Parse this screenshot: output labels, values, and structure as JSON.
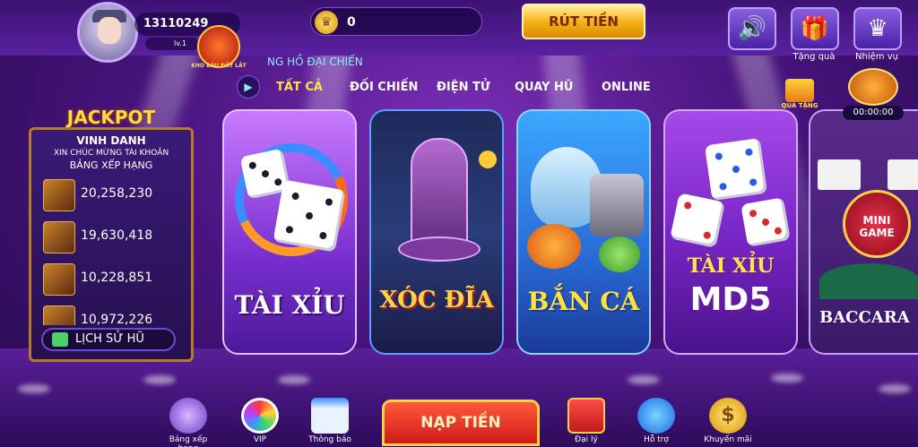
{
  "user": {
    "id": "13110249",
    "level": "lv.1"
  },
  "event_badge": "KHO BÁU ĐẦY LẮT",
  "wallet": {
    "coins": "0",
    "crown_icon": "crown-coin-icon"
  },
  "withdraw_label": "RÚT TIỀN",
  "top_buttons": [
    {
      "name": "sound",
      "icon": "speaker-icon",
      "label": ""
    },
    {
      "name": "gift",
      "icon": "gift-box-icon",
      "label": "Tặng quà"
    },
    {
      "name": "mission",
      "icon": "crown-icon",
      "label": "Nhiệm vụ"
    }
  ],
  "ticker_text": "NG HỒ ĐẠI CHIẾN",
  "tabs": [
    "TẤT CẢ",
    "ĐỐI CHIẾN",
    "ĐIỆN TỬ",
    "QUAY HŨ",
    "ONLINE"
  ],
  "active_tab": "TẤT CẢ",
  "jackpot": {
    "title": "JACKPOT",
    "heading": "VINH DANH",
    "subheading": "XIN CHÚC MỪNG TÀI KHOẢN",
    "board": "BẢNG XẾP HẠNG",
    "entries": [
      "20,258,230",
      "19,630,418",
      "10,228,851",
      "10,972,226"
    ],
    "history_label": "LỊCH SỬ HŨ"
  },
  "games": [
    "TÀI XỈU",
    "XÓC ĐĨA",
    "BẮN CÁ",
    "TÀI XỈU",
    "MD5",
    "BACCARA"
  ],
  "mini_game_label": "MINI GAME",
  "gift_label": "QUÀ TẶNG",
  "timer": "00:00:00",
  "bottom_nav": [
    {
      "label": "Bảng xếp hạng",
      "icon": "trophy-icon"
    },
    {
      "label": "VIP",
      "icon": "vip-wheel-icon"
    },
    {
      "label": "Thông báo",
      "icon": "calendar-icon"
    },
    {
      "label": "Đại lý",
      "icon": "gift-icon"
    },
    {
      "label": "Hỗ trợ",
      "icon": "support-icon"
    },
    {
      "label": "Khuyến mãi",
      "icon": "dollar-coin-icon"
    }
  ],
  "deposit_label": "NẠP TIỀN"
}
